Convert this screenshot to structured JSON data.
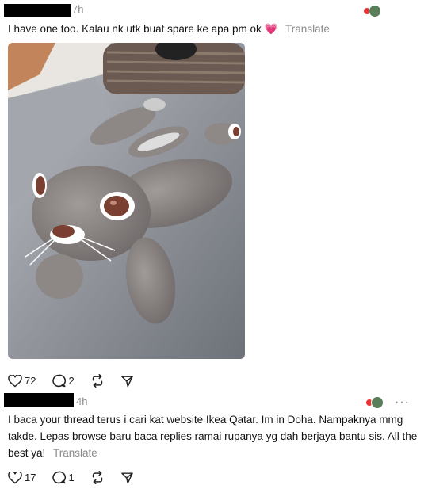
{
  "post1": {
    "time": "7h",
    "text": "I have one too. Kalau nk utk buat spare ke apa pm ok",
    "emoji": "💗",
    "translate": "Translate",
    "likes": "72",
    "replies": "2"
  },
  "post2": {
    "time": "4h",
    "text": "I baca your thread terus i cari kat website Ikea Qatar. Im in Doha. Nampaknya mmg takde. Lepas browse baru baca replies ramai rupanya yg dah berjaya bantu sis. All the best ya!",
    "translate": "Translate",
    "likes": "17",
    "replies": "1",
    "more": "···"
  },
  "icons": [
    "heart-icon",
    "comment-icon",
    "repost-icon",
    "share-icon",
    "more-icon"
  ]
}
